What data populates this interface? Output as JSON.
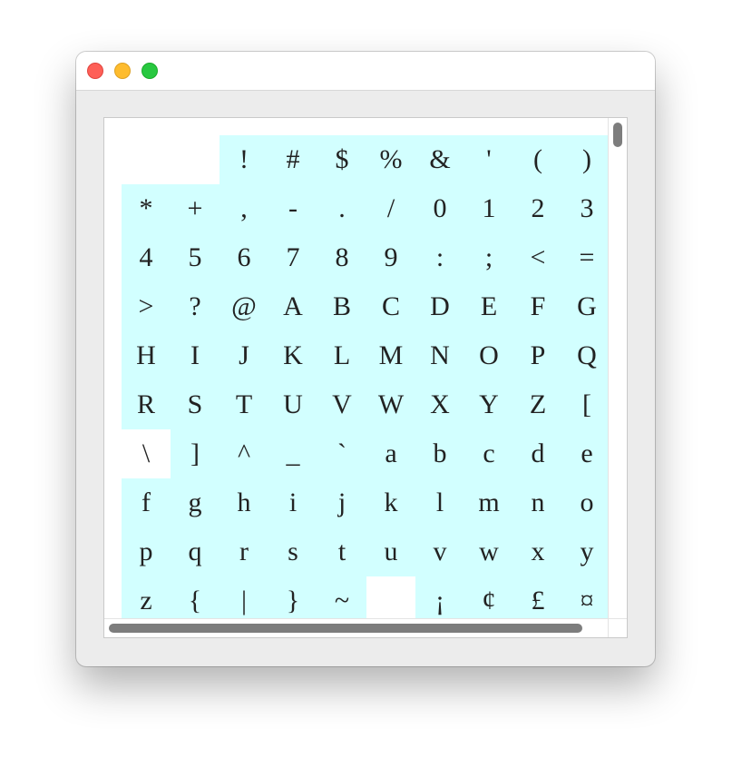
{
  "window": {
    "controls": [
      "close",
      "minimize",
      "zoom"
    ]
  },
  "glyph_table": {
    "cells": [
      "",
      "",
      "!",
      "#",
      "$",
      "%",
      "&",
      "'",
      "(",
      ")",
      "*",
      "+",
      ",",
      "-",
      ".",
      "/",
      "0",
      "1",
      "2",
      "3",
      "4",
      "5",
      "6",
      "7",
      "8",
      "9",
      ":",
      ";",
      "<",
      "=",
      ">",
      "?",
      "@",
      "A",
      "B",
      "C",
      "D",
      "E",
      "F",
      "G",
      "H",
      "I",
      "J",
      "K",
      "L",
      "M",
      "N",
      "O",
      "P",
      "Q",
      "R",
      "S",
      "T",
      "U",
      "V",
      "W",
      "X",
      "Y",
      "Z",
      "[",
      "\\",
      "]",
      "^",
      "_",
      "`",
      "a",
      "b",
      "c",
      "d",
      "e",
      "f",
      "g",
      "h",
      "i",
      "j",
      "k",
      "l",
      "m",
      "n",
      "o",
      "p",
      "q",
      "r",
      "s",
      "t",
      "u",
      "v",
      "w",
      "x",
      "y",
      "z",
      "{",
      "|",
      "}",
      "~",
      "",
      "¡",
      "¢",
      "£",
      "¤"
    ],
    "blank_cells": [
      0,
      1,
      60,
      95
    ],
    "colors": {
      "cell_background": "#d2ffff",
      "blank_background": "#ffffff",
      "glyph": "#222222"
    }
  }
}
